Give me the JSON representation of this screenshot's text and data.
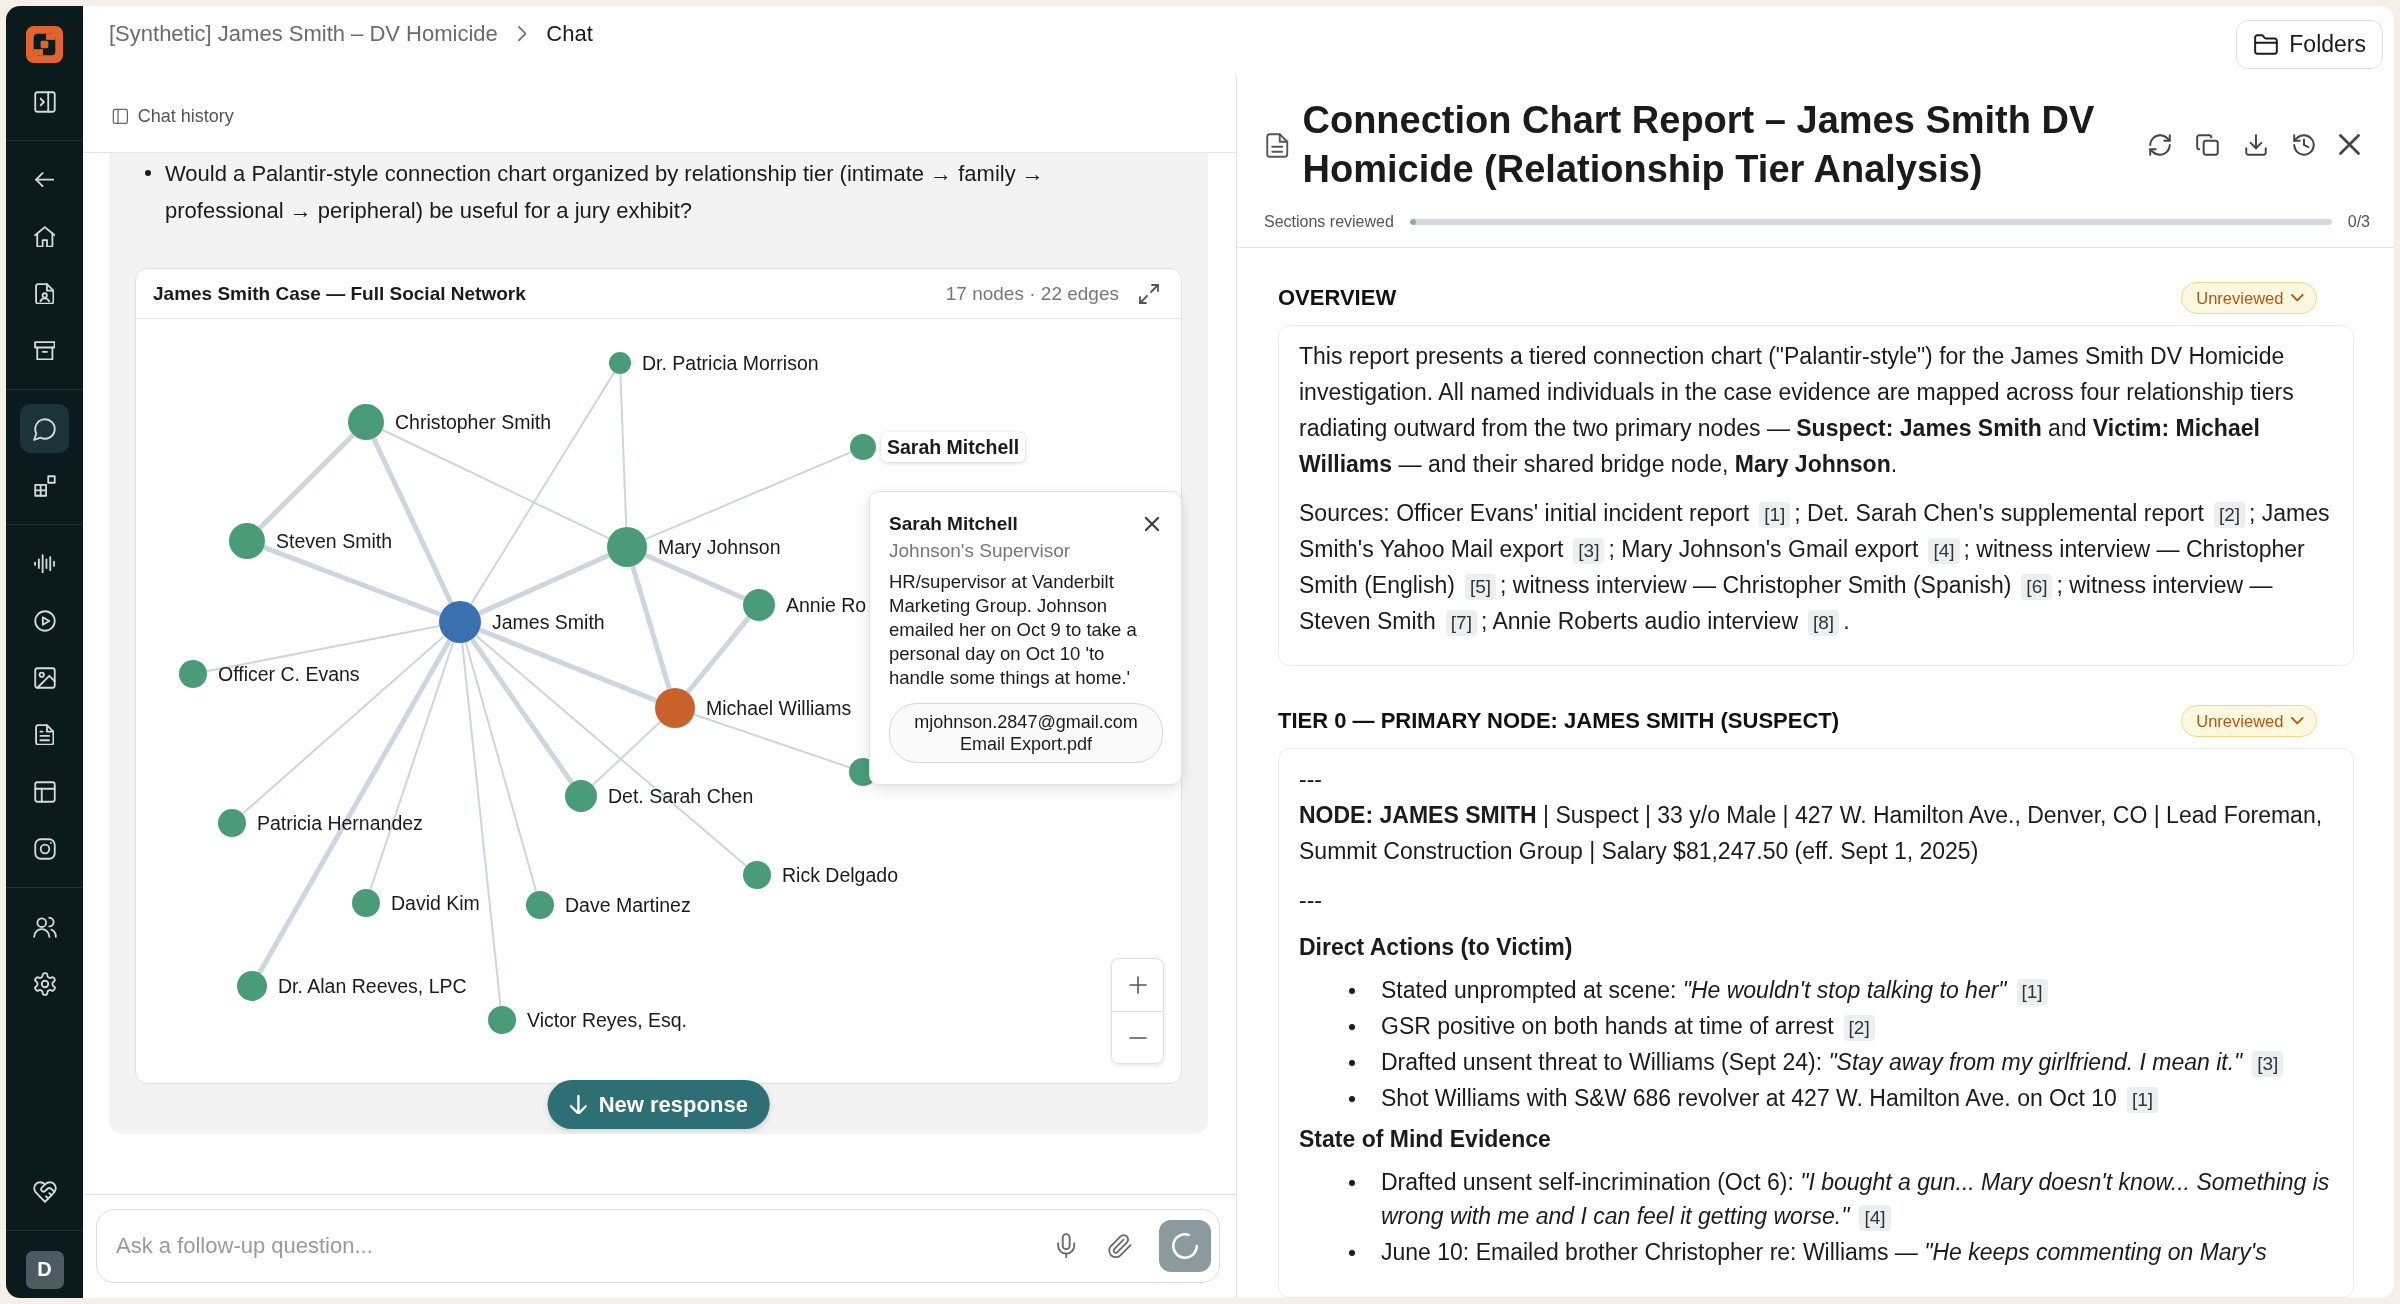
{
  "sidebar": {
    "items": [
      {
        "selected": false
      },
      {
        "selected": false
      },
      {
        "selected": false
      },
      {
        "selected": false
      },
      {
        "selected": false
      },
      {
        "selected": true
      },
      {
        "selected": false
      },
      {
        "selected": false
      },
      {
        "selected": false
      },
      {
        "selected": false
      },
      {
        "selected": false
      },
      {
        "selected": false
      },
      {
        "selected": false
      },
      {
        "selected": false
      },
      {
        "selected": false
      },
      {
        "selected": false
      }
    ],
    "avatar": "D"
  },
  "breadcrumb": [
    {
      "label": "[Synthetic] James Smith – DV Homicide",
      "current": false
    },
    {
      "label": "Chat",
      "current": true
    }
  ],
  "chat": {
    "history_button": "Chat history",
    "message_bullets": [
      "Would a Palantir-style connection chart organized by relationship tier (intimate → family → professional → peripheral) be useful for a jury exhibit?"
    ],
    "graph": {
      "title": "James Smith Case — Full Social Network",
      "stats": "17 nodes · 22 edges",
      "nodes": [
        {
          "label": "Dr. Patricia Morrison",
          "color": "#4a9c78",
          "selected": false
        },
        {
          "label": "Christopher Smith",
          "color": "#4a9c78",
          "selected": false
        },
        {
          "label": "Sarah Mitchell",
          "color": "#4a9c78",
          "selected": true
        },
        {
          "label": "Steven Smith",
          "color": "#4a9c78",
          "selected": false
        },
        {
          "label": "Mary Johnson",
          "color": "#4a9c78",
          "selected": false
        },
        {
          "label": "Annie Ro",
          "color": "#4a9c78",
          "selected": false
        },
        {
          "label": "James Smith",
          "color": "#3a70ad",
          "selected": false
        },
        {
          "label": "Officer C. Evans",
          "color": "#4a9c78",
          "selected": false
        },
        {
          "label": "Michael Williams",
          "color": "#c8622a",
          "selected": false
        },
        {
          "color": "#4a9c78",
          "selected": false
        },
        {
          "label": "Det. Sarah Chen",
          "color": "#4a9c78",
          "selected": false
        },
        {
          "label": "Patricia Hernandez",
          "color": "#4a9c78",
          "selected": false
        },
        {
          "label": "Rick Delgado",
          "color": "#4a9c78",
          "selected": false
        },
        {
          "label": "David Kim",
          "color": "#4a9c78",
          "selected": false
        },
        {
          "label": "Dave Martinez",
          "color": "#4a9c78",
          "selected": false
        },
        {
          "label": "Dr. Alan Reeves, LPC",
          "color": "#4a9c78",
          "selected": false
        },
        {
          "label": "Victor Reyes, Esq.",
          "color": "#4a9c78",
          "selected": false
        }
      ],
      "popup": {
        "title": "Sarah Mitchell",
        "subtitle": "Johnson's Supervisor",
        "text": "HR/supervisor at Vanderbilt Marketing Group. Johnson emailed her on Oct 9 to take a personal day on Oct 10 'to handle some things at home.'",
        "attachment": [
          "mjohnson.2847@gmail.com",
          "Email Export.pdf"
        ]
      }
    },
    "new_response_button": "New response",
    "composer": {
      "placeholder": "Ask a follow-up question..."
    }
  },
  "folders_button": "Folders",
  "report": {
    "title": "Connection Chart Report – James Smith DV Homicide (Relationship Tier Analysis)",
    "progress": {
      "label": "Sections reviewed",
      "level": 0,
      "reading": "0/3"
    },
    "sections": [
      {
        "heading": "OVERVIEW",
        "status": "Unreviewed",
        "blocks": [
          {
            "kind": "paragraph",
            "text": "This report presents a tiered connection chart (\"Palantir-style\") for the James Smith DV Homicide investigation. All named individuals in the case evidence are mapped across four relationship tiers radiating outward from the two primary nodes — **Suspect: James Smith** and **Victim: Michael Williams** — and their shared bridge node, **Mary Johnson**."
          },
          {
            "kind": "sources",
            "parts": [
              {
                "text": "Sources: Officer Evans' initial incident report",
                "cite": "[1]"
              },
              {
                "text": "; Det. Sarah Chen's supplemental report",
                "cite": "[2]"
              },
              {
                "text": "; James Smith's Yahoo Mail export",
                "cite": "[3]"
              },
              {
                "text": "; Mary Johnson's Gmail export",
                "cite": "[4]"
              },
              {
                "text": "; witness interview — Christopher Smith (English)",
                "cite": "[5]"
              },
              {
                "text": "; witness interview — Christopher Smith (Spanish)",
                "cite": "[6]"
              },
              {
                "text": "; witness interview — Steven Smith",
                "cite": "[7]"
              },
              {
                "text": "; Annie Roberts audio interview",
                "cite": "[8]"
              }
            ],
            "end": "."
          }
        ]
      },
      {
        "heading": "TIER 0 — PRIMARY NODE: JAMES SMITH (SUSPECT)",
        "status": "Unreviewed",
        "blocks": [
          {
            "kind": "dashes",
            "text": "---"
          },
          {
            "kind": "paragraph",
            "text": "**NODE: JAMES SMITH** | Suspect | 33 y/o Male | 427 W. Hamilton Ave., Denver, CO | Lead Foreman, Summit Construction Group | Salary $81,247.50 (eff. Sept 1, 2025)"
          },
          {
            "kind": "dashes",
            "text": "---"
          },
          {
            "kind": "subheading",
            "text": "Direct Actions (to Victim)"
          },
          {
            "kind": "list",
            "items": [
              {
                "text": "Stated unprompted at scene: *\"He wouldn't stop talking to her\"*",
                "cite": "[1]"
              },
              {
                "text": "GSR positive on both hands at time of arrest",
                "cite": "[2]"
              },
              {
                "text": "Drafted unsent threat to Williams (Sept 24): *\"Stay away from my girlfriend. I mean it.\"*",
                "cite": "[3]"
              },
              {
                "text": "Shot Williams with S&W 686 revolver at 427 W. Hamilton Ave. on Oct 10",
                "cite": "[1]"
              }
            ]
          },
          {
            "kind": "subheading",
            "text": "State of Mind Evidence"
          },
          {
            "kind": "list",
            "items": [
              {
                "text": "Drafted unsent self-incrimination (Oct 6): *\"I bought a gun... Mary doesn't know... Something is wrong with me and I can feel it getting worse.\"*",
                "cite": "[4]"
              },
              {
                "text": "June 10: Emailed brother Christopher re: Williams — *\"He keeps commenting on Mary's*"
              }
            ]
          }
        ]
      }
    ]
  }
}
